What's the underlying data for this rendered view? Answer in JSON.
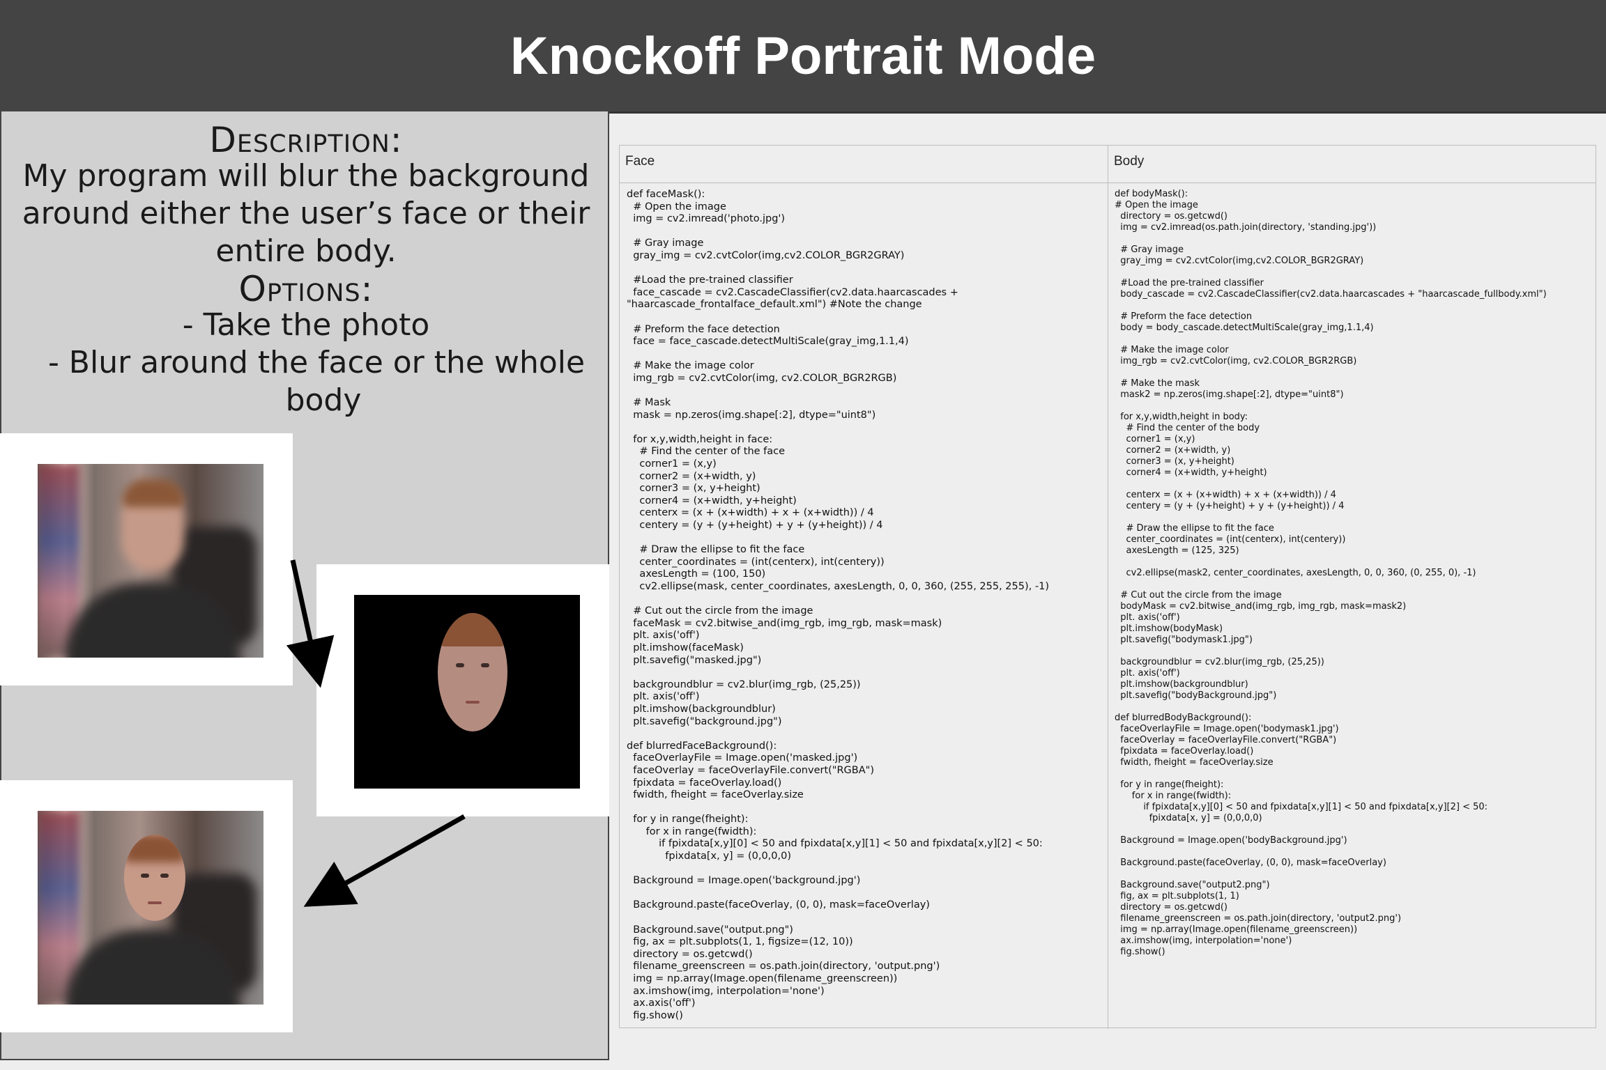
{
  "title": "Knockoff Portrait Mode",
  "description": {
    "heading": "Description:",
    "text_lines": [
      "My program will blur the background",
      "around either the user’s face or their",
      "entire body."
    ],
    "options_heading": "Options:",
    "options": [
      "-  Take the photo",
      "-  Blur around the face or the whole",
      "body"
    ]
  },
  "images": [
    {
      "name": "blurred-background-photo",
      "alt": "Blurred photo of user"
    },
    {
      "name": "face-mask-photo",
      "alt": "Masked face on black background"
    },
    {
      "name": "portrait-mode-result-photo",
      "alt": "Face sharp with blurred background"
    }
  ],
  "code_table": {
    "face_header": "Face",
    "body_header": "Body",
    "face_code": "def faceMask():\n  # Open the image\n  img = cv2.imread('photo.jpg')\n\n  # Gray image\n  gray_img = cv2.cvtColor(img,cv2.COLOR_BGR2GRAY)\n\n  #Load the pre-trained classifier\n  face_cascade = cv2.CascadeClassifier(cv2.data.haarcascades +\n\"haarcascade_frontalface_default.xml\") #Note the change\n\n  # Preform the face detection\n  face = face_cascade.detectMultiScale(gray_img,1.1,4)\n\n  # Make the image color\n  img_rgb = cv2.cvtColor(img, cv2.COLOR_BGR2RGB)\n\n  # Mask\n  mask = np.zeros(img.shape[:2], dtype=\"uint8\")\n\n  for x,y,width,height in face:\n    # Find the center of the face\n    corner1 = (x,y)\n    corner2 = (x+width, y)\n    corner3 = (x, y+height)\n    corner4 = (x+width, y+height)\n    centerx = (x + (x+width) + x + (x+width)) / 4\n    centery = (y + (y+height) + y + (y+height)) / 4\n\n    # Draw the ellipse to fit the face\n    center_coordinates = (int(centerx), int(centery))\n    axesLength = (100, 150)\n    cv2.ellipse(mask, center_coordinates, axesLength, 0, 0, 360, (255, 255, 255), -1)\n\n  # Cut out the circle from the image\n  faceMask = cv2.bitwise_and(img_rgb, img_rgb, mask=mask)\n  plt. axis('off')\n  plt.imshow(faceMask)\n  plt.savefig(\"masked.jpg\")\n\n  backgroundblur = cv2.blur(img_rgb, (25,25))\n  plt. axis('off')\n  plt.imshow(backgroundblur)\n  plt.savefig(\"background.jpg\")\n\ndef blurredFaceBackground():\n  faceOverlayFile = Image.open('masked.jpg')\n  faceOverlay = faceOverlayFile.convert(\"RGBA\")\n  fpixdata = faceOverlay.load()\n  fwidth, fheight = faceOverlay.size\n\n  for y in range(fheight):\n      for x in range(fwidth):\n          if fpixdata[x,y][0] < 50 and fpixdata[x,y][1] < 50 and fpixdata[x,y][2] < 50:\n            fpixdata[x, y] = (0,0,0,0)\n\n  Background = Image.open('background.jpg')\n\n  Background.paste(faceOverlay, (0, 0), mask=faceOverlay)\n\n  Background.save(\"output.png\")\n  fig, ax = plt.subplots(1, 1, figsize=(12, 10))\n  directory = os.getcwd()\n  filename_greenscreen = os.path.join(directory, 'output.png')\n  img = np.array(Image.open(filename_greenscreen))\n  ax.imshow(img, interpolation='none')\n  ax.axis('off')\n  fig.show()",
    "body_code": "def bodyMask():\n# Open the image\n  directory = os.getcwd()\n  img = cv2.imread(os.path.join(directory, 'standing.jpg'))\n\n  # Gray image\n  gray_img = cv2.cvtColor(img,cv2.COLOR_BGR2GRAY)\n\n  #Load the pre-trained classifier\n  body_cascade = cv2.CascadeClassifier(cv2.data.haarcascades + \"haarcascade_fullbody.xml\")\n\n  # Preform the face detection\n  body = body_cascade.detectMultiScale(gray_img,1.1,4)\n\n  # Make the image color\n  img_rgb = cv2.cvtColor(img, cv2.COLOR_BGR2RGB)\n\n  # Make the mask\n  mask2 = np.zeros(img.shape[:2], dtype=\"uint8\")\n\n  for x,y,width,height in body:\n    # Find the center of the body\n    corner1 = (x,y)\n    corner2 = (x+width, y)\n    corner3 = (x, y+height)\n    corner4 = (x+width, y+height)\n\n    centerx = (x + (x+width) + x + (x+width)) / 4\n    centery = (y + (y+height) + y + (y+height)) / 4\n\n    # Draw the ellipse to fit the face\n    center_coordinates = (int(centerx), int(centery))\n    axesLength = (125, 325)\n\n    cv2.ellipse(mask2, center_coordinates, axesLength, 0, 0, 360, (0, 255, 0), -1)\n\n  # Cut out the circle from the image\n  bodyMask = cv2.bitwise_and(img_rgb, img_rgb, mask=mask2)\n  plt. axis('off')\n  plt.imshow(bodyMask)\n  plt.savefig(\"bodymask1.jpg\")\n\n  backgroundblur = cv2.blur(img_rgb, (25,25))\n  plt. axis('off')\n  plt.imshow(backgroundblur)\n  plt.savefig(\"bodyBackground.jpg\")\n\ndef blurredBodyBackground():\n  faceOverlayFile = Image.open('bodymask1.jpg')\n  faceOverlay = faceOverlayFile.convert(\"RGBA\")\n  fpixdata = faceOverlay.load()\n  fwidth, fheight = faceOverlay.size\n\n  for y in range(fheight):\n      for x in range(fwidth):\n          if fpixdata[x,y][0] < 50 and fpixdata[x,y][1] < 50 and fpixdata[x,y][2] < 50:\n            fpixdata[x, y] = (0,0,0,0)\n\n  Background = Image.open('bodyBackground.jpg')\n\n  Background.paste(faceOverlay, (0, 0), mask=faceOverlay)\n\n  Background.save(\"output2.png\")\n  fig, ax = plt.subplots(1, 1)\n  directory = os.getcwd()\n  filename_greenscreen = os.path.join(directory, 'output2.png')\n  img = np.array(Image.open(filename_greenscreen))\n  ax.imshow(img, interpolation='none')\n  fig.show()"
  },
  "colors": {
    "title_bar": "#444444",
    "left_panel": "#d1d1d1",
    "page_background": "#eeeeee",
    "arrow": "#000000"
  }
}
